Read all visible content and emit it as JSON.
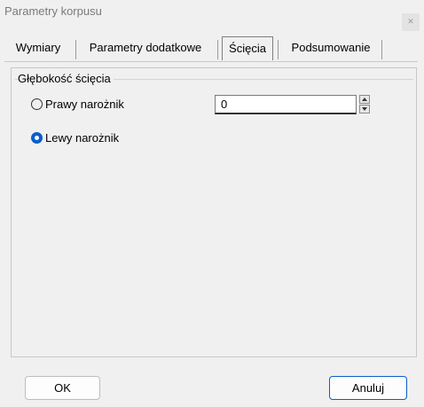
{
  "window": {
    "title": "Parametry korpusu"
  },
  "tabs": [
    {
      "label": "Wymiary"
    },
    {
      "label": "Parametry dodatkowe"
    },
    {
      "label": "Ścięcia",
      "active": true
    },
    {
      "label": "Podsumowanie"
    }
  ],
  "group": {
    "label": "Głębokość ścięcia",
    "options": [
      {
        "label": "Prawy narożnik",
        "selected": false
      },
      {
        "label": "Lewy narożnik",
        "selected": true
      }
    ],
    "value_field": {
      "value": "0"
    }
  },
  "footer": {
    "ok_label": "OK",
    "cancel_label": "Anuluj"
  },
  "colors": {
    "accent": "#0a5fc7",
    "background": "#f0f0f0"
  },
  "icons": {
    "close": "close-icon",
    "spin_up": "chevron-up-icon",
    "spin_down": "chevron-down-icon"
  }
}
